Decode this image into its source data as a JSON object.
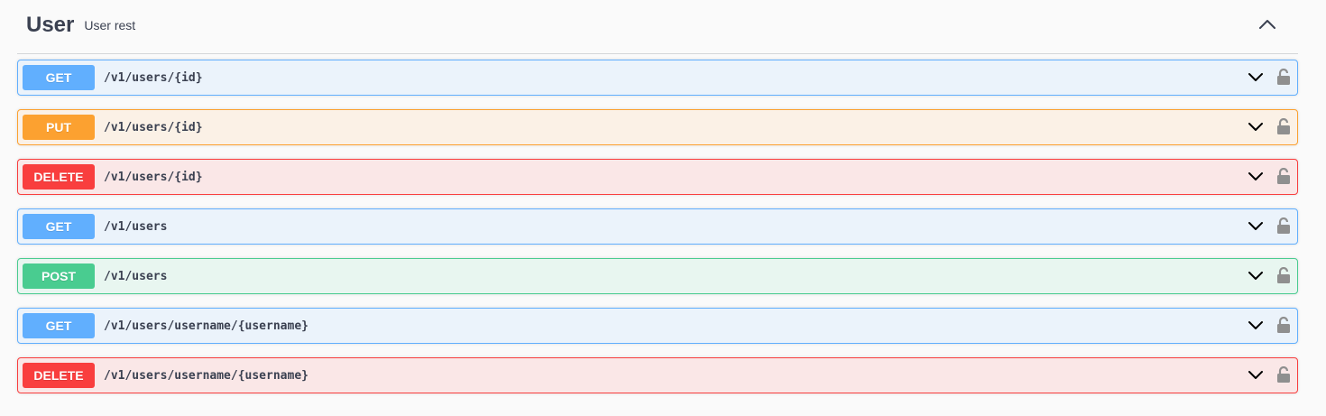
{
  "tag": {
    "name": "User",
    "description": "User rest",
    "expanded_icon": "chevron-up-icon"
  },
  "operations": [
    {
      "method": "GET",
      "path": "/v1/users/{id}",
      "kind": "get"
    },
    {
      "method": "PUT",
      "path": "/v1/users/{id}",
      "kind": "put"
    },
    {
      "method": "DELETE",
      "path": "/v1/users/{id}",
      "kind": "delete"
    },
    {
      "method": "GET",
      "path": "/v1/users",
      "kind": "get"
    },
    {
      "method": "POST",
      "path": "/v1/users",
      "kind": "post"
    },
    {
      "method": "GET",
      "path": "/v1/users/username/{username}",
      "kind": "get"
    },
    {
      "method": "DELETE",
      "path": "/v1/users/username/{username}",
      "kind": "delete"
    }
  ],
  "icons": {
    "expand": "chevron-down-icon",
    "auth": "lock-icon"
  },
  "colors": {
    "get": "#61affe",
    "put": "#fca130",
    "delete": "#f93e3e",
    "post": "#49cc90",
    "text": "#3b4151"
  }
}
